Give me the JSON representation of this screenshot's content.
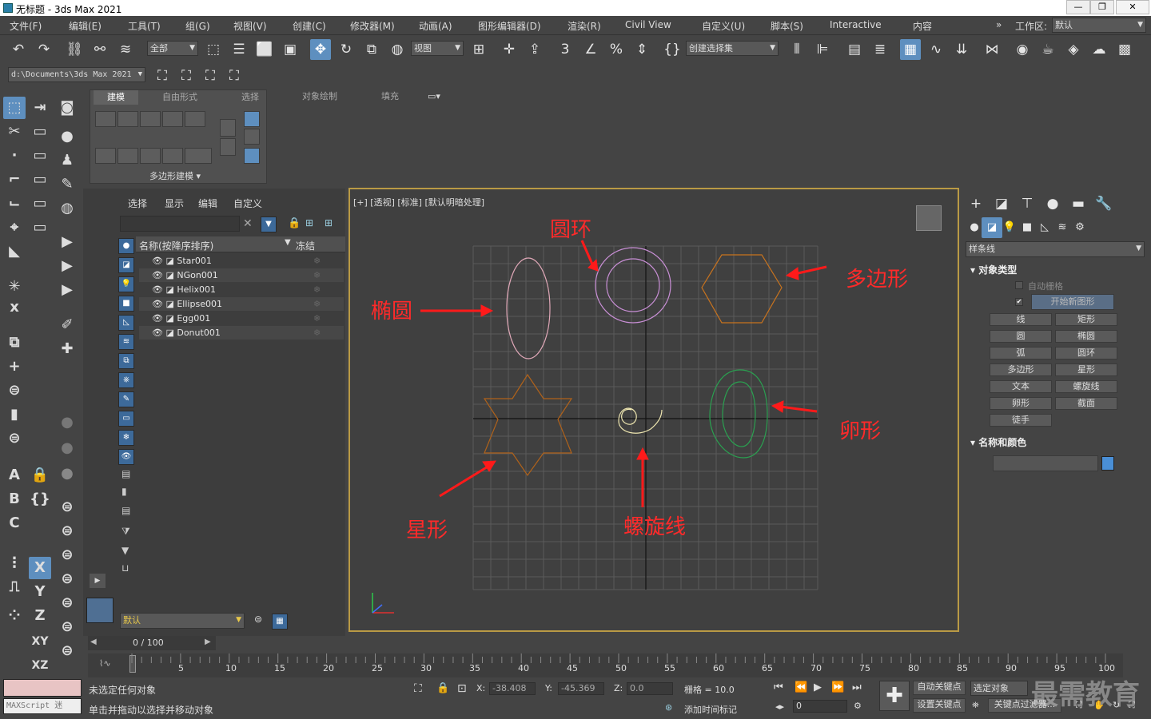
{
  "window": {
    "title": "无标题 - 3ds Max 2021"
  },
  "menu": [
    "文件(F)",
    "编辑(E)",
    "工具(T)",
    "组(G)",
    "视图(V)",
    "创建(C)",
    "修改器(M)",
    "动画(A)",
    "图形编辑器(D)",
    "渲染(R)",
    "Civil View",
    "自定义(U)",
    "脚本(S)",
    "Interactive",
    "内容"
  ],
  "workspace": {
    "label": "工作区:",
    "value": "默认"
  },
  "toolbar": {
    "selection_filter": "全部",
    "ref_coord": "视图",
    "named_sel": "创建选择集"
  },
  "project": {
    "path": "d:\\Documents\\3ds Max 2021"
  },
  "ribbon": {
    "tabs": [
      "建模",
      "自由形式",
      "选择",
      "对象绘制",
      "填充"
    ],
    "group": "多边形建模"
  },
  "scene_explorer": {
    "tabs": [
      "选择",
      "显示",
      "编辑",
      "自定义"
    ],
    "col_name": "名称(按降序排序)",
    "col_frozen": "冻结",
    "items": [
      "Star001",
      "NGon001",
      "Helix001",
      "Ellipse001",
      "Egg001",
      "Donut001"
    ],
    "layer": "默认"
  },
  "viewport": {
    "label": "[+] [透视] [标准] [默认明暗处理]"
  },
  "annotations": {
    "donut": "圆环",
    "ngon": "多边形",
    "ellipse": "椭圆",
    "egg": "卵形",
    "star": "星形",
    "helix": "螺旋线"
  },
  "command_panel": {
    "category": "样条线",
    "object_type_header": "对象类型",
    "autogrid": "自动栅格",
    "start_new_shape": "开始新图形",
    "buttons": [
      "线",
      "矩形",
      "圆",
      "椭圆",
      "弧",
      "圆环",
      "多边形",
      "星形",
      "文本",
      "螺旋线",
      "卵形",
      "截面",
      "徒手"
    ],
    "name_color_header": "名称和颜色",
    "object_color": "#4a8fd6"
  },
  "timeline": {
    "frame_display": "0 / 100",
    "ticks": [
      "5",
      "10",
      "15",
      "20",
      "25",
      "30",
      "35",
      "40",
      "45",
      "50",
      "55",
      "60",
      "65",
      "70",
      "75",
      "80",
      "85",
      "90",
      "95",
      "100"
    ]
  },
  "status": {
    "maxscript": "MAXScript 迷",
    "line1": "未选定任何对象",
    "line2": "单击并拖动以选择并移动对象",
    "x_label": "X:",
    "x": "-38.408",
    "y_label": "Y:",
    "y": "-45.369",
    "z_label": "Z:",
    "z": "0.0",
    "grid": "栅格 = 10.0",
    "add_time_tag": "添加时间标记",
    "frame": "0",
    "autokey": "自动关键点",
    "setkey": "设置关键点",
    "selected": "选定对象",
    "key_filters": "关键点过滤器...",
    "watermark": "最需教育"
  }
}
